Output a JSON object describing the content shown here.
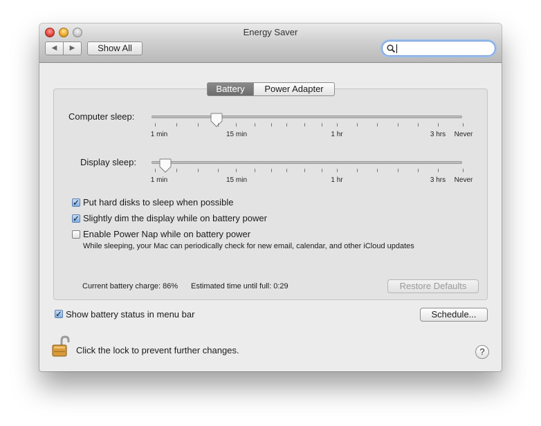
{
  "window": {
    "title": "Energy Saver",
    "back_icon": "◀",
    "forward_icon": "▶",
    "show_all_label": "Show All",
    "search": {
      "value": "",
      "icon": "search-icon"
    }
  },
  "tabs": [
    {
      "label": "Battery",
      "selected": true
    },
    {
      "label": "Power Adapter",
      "selected": false
    }
  ],
  "sliders": [
    {
      "label": "Computer sleep:",
      "value_position": 0.21,
      "tick_labels": [
        "1 min",
        "15 min",
        "1 hr",
        "3 hrs",
        "Never"
      ]
    },
    {
      "label": "Display sleep:",
      "value_position": 0.045,
      "tick_labels": [
        "1 min",
        "15 min",
        "1 hr",
        "3 hrs",
        "Never"
      ]
    }
  ],
  "options": [
    {
      "label": "Put hard disks to sleep when possible",
      "checked": true
    },
    {
      "label": "Slightly dim the display while on battery power",
      "checked": true
    },
    {
      "label": "Enable Power Nap while on battery power",
      "checked": false
    }
  ],
  "power_nap_description": "While sleeping, your Mac can periodically check for new email, calendar, and other iCloud updates",
  "status": {
    "charge_text": "Current battery charge: 86%",
    "time_text": "Estimated time until full: 0:29"
  },
  "restore_defaults_label": "Restore Defaults",
  "menu_bar_option": {
    "label": "Show battery status in menu bar",
    "checked": true
  },
  "schedule_label": "Schedule...",
  "lock_text": "Click the lock to prevent further changes.",
  "help_label": "?",
  "colors": {
    "accent": "#6b95d6",
    "selected_tab": "#777777"
  }
}
